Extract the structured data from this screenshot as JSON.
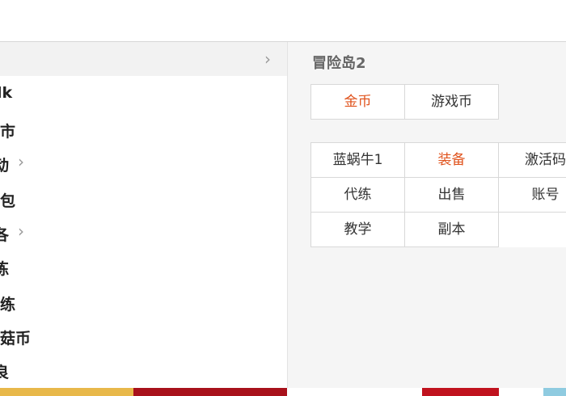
{
  "menu": {
    "items": [
      {
        "label": ""
      },
      {
        "label": "lk"
      },
      {
        "label": "市"
      },
      {
        "label": "动"
      },
      {
        "label": "包"
      },
      {
        "label": "各"
      },
      {
        "label": "练"
      },
      {
        "label": "练"
      },
      {
        "label": "菇币"
      },
      {
        "label": "良"
      }
    ]
  },
  "panel": {
    "title": "冒险岛2",
    "currency_tabs": [
      "金币",
      "游戏币"
    ],
    "categories": [
      "蓝蜗牛1",
      "装备",
      "激活码",
      "代练",
      "出售",
      "账号",
      "教学",
      "副本"
    ]
  },
  "icons": {
    "chevron": "chevron-right-icon"
  },
  "colors": {
    "highlight": "#e0531d"
  }
}
